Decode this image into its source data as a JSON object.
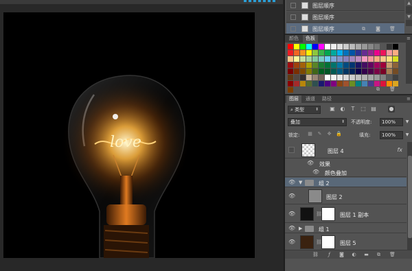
{
  "history": {
    "rows": [
      {
        "label": "图层顺序"
      },
      {
        "label": "图层顺序"
      },
      {
        "label": "图层顺序"
      }
    ]
  },
  "swatch_tabs": {
    "tab1": "颜色",
    "tab2": "色板"
  },
  "swatch_colors": [
    "#ff0000",
    "#ffff00",
    "#00ff00",
    "#00ffff",
    "#0000ff",
    "#ff00ff",
    "#ffffff",
    "#eeeeee",
    "#dddddd",
    "#cccccc",
    "#bbbbbb",
    "#aaaaaa",
    "#999999",
    "#888888",
    "#777777",
    "#555555",
    "#333333",
    "#000000",
    "#ee1d24",
    "#f26522",
    "#f7941d",
    "#fff200",
    "#8dc63f",
    "#39b54a",
    "#00a651",
    "#00a99d",
    "#00aeef",
    "#0072bc",
    "#0054a6",
    "#2e3192",
    "#662d91",
    "#92278f",
    "#ec008c",
    "#ed145b",
    "#f6989d",
    "#fbad82",
    "#fdc689",
    "#fff799",
    "#c4df9b",
    "#a3d39c",
    "#82ca9c",
    "#7accc8",
    "#6dcff6",
    "#7da7d9",
    "#8493ca",
    "#8781bd",
    "#a186be",
    "#bd8cbf",
    "#f49ac1",
    "#f5989d",
    "#f9ad81",
    "#fdc68a",
    "#ffe17b",
    "#d9e021",
    "#9e0b0f",
    "#a0410d",
    "#a3620a",
    "#aba000",
    "#598527",
    "#197b30",
    "#007236",
    "#00746b",
    "#0076a3",
    "#004b80",
    "#003471",
    "#1b1464",
    "#440e62",
    "#630460",
    "#9e005d",
    "#9e0039",
    "#c69c6d",
    "#8c6239",
    "#790000",
    "#7b2e00",
    "#7d4900",
    "#827b00",
    "#406618",
    "#005e20",
    "#005826",
    "#005952",
    "#005b7f",
    "#003663",
    "#002157",
    "#0d004c",
    "#32004b",
    "#4b0049",
    "#7b0046",
    "#7a0026",
    "#a67c52",
    "#754c24",
    "#603913",
    "#534741",
    "#362f2d",
    "#c7b299",
    "#998675",
    "#736357",
    "#ffffff",
    "#f2f2f2",
    "#e6e6e6",
    "#d9d9d9",
    "#cccccc",
    "#bfbfbf",
    "#b3b3b3",
    "#a6a6a6",
    "#999999",
    "#808080",
    "#595959",
    "#404040",
    "#8b0000",
    "#a52a2a",
    "#b8860b",
    "#556b2f",
    "#2f4f4f",
    "#191970",
    "#4b0082",
    "#800080",
    "#8b4513",
    "#a0522d",
    "#6b8e23",
    "#008080",
    "#4682b4",
    "#483d8b",
    "#c71585",
    "#dc143c",
    "#ff8c00",
    "#daa520",
    "#7b3f00"
  ],
  "layers_tabs": {
    "tab1": "图层",
    "tab2": "通道",
    "tab3": "路径"
  },
  "layers_panel": {
    "filter_kind": "类型",
    "blend_mode": "叠加",
    "opacity_label": "不透明度:",
    "opacity_value": "100%",
    "lock_label": "锁定:",
    "fill_label": "填充:",
    "fill_value": "100%"
  },
  "layers": [
    {
      "name": "图层 4",
      "fx": "fx"
    },
    {
      "name": "效果"
    },
    {
      "name": "颜色叠加"
    },
    {
      "name": "组 2"
    },
    {
      "name": "图层 2"
    },
    {
      "name": "图层 1 副本"
    },
    {
      "name": "组 1"
    },
    {
      "name": "图层 5"
    }
  ],
  "canvas": {
    "script_text": "love"
  }
}
